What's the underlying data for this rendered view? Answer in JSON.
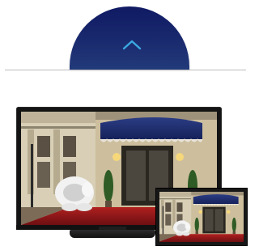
{
  "collapse_tab": {
    "icon": "chevron-up-icon",
    "color": "#1a2a6e",
    "chevron_color": "#3aa8e0"
  },
  "images": {
    "tv": "tv-with-storefront-scene-image",
    "second_screen": "second-screen-mirrored-scene-image"
  }
}
